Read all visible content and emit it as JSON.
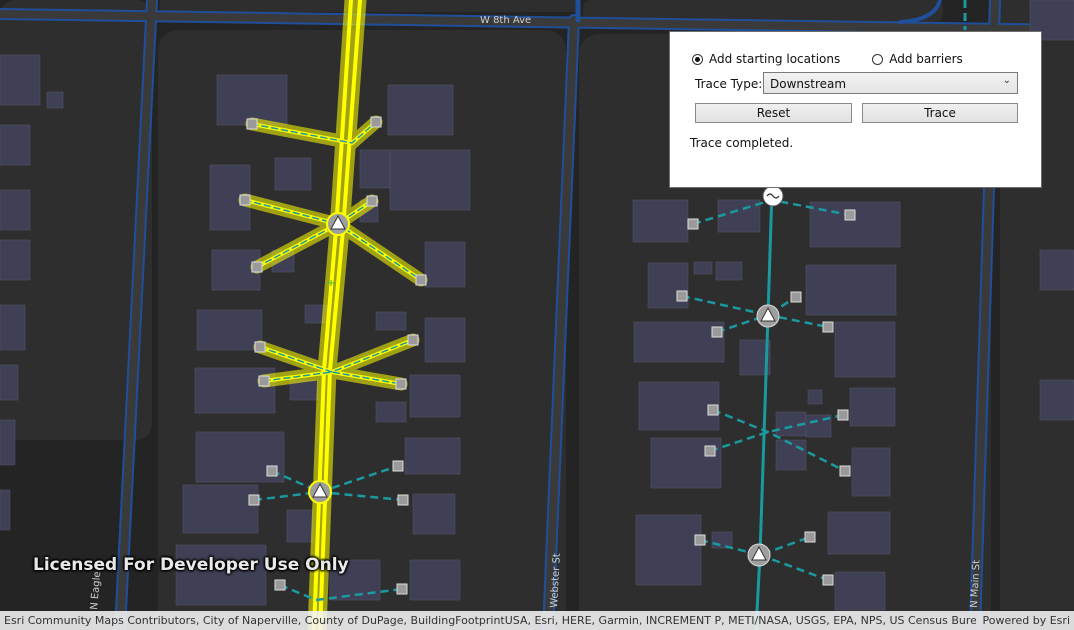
{
  "map": {
    "street_labels": {
      "w8th": "W 8th Ave",
      "eagle": "N Eagle",
      "webster": "Webster St",
      "main": "N Main St"
    },
    "colors": {
      "background": "#242424",
      "block": "#2e2e2e",
      "road_fill": "#3a3a3a",
      "road_edge": "#1f4f9a",
      "building": "#3f3f55",
      "utility_line": "#1a9aa0",
      "trace_highlight": "#ffff00"
    },
    "icons": [
      "device-square-icon",
      "transformer-triangle-icon",
      "switch-circle-icon",
      "starting-location-marker-icon"
    ]
  },
  "panel": {
    "radio_add_starting": "Add starting locations",
    "radio_add_starting_checked": true,
    "radio_add_barriers": "Add barriers",
    "radio_add_barriers_checked": false,
    "trace_type_label": "Trace Type:",
    "trace_type_value": "Downstream",
    "reset_label": "Reset",
    "trace_label": "Trace",
    "status": "Trace completed."
  },
  "watermark": "Licensed For Developer Use Only",
  "attribution": {
    "text": "Esri Community Maps Contributors, City of Naperville, County of DuPage, BuildingFootprintUSA, Esri, HERE, Garmin, INCREMENT P, METI/NASA, USGS, EPA, NPS, US Census Bureau, U...",
    "powered": "Powered by Esri"
  }
}
